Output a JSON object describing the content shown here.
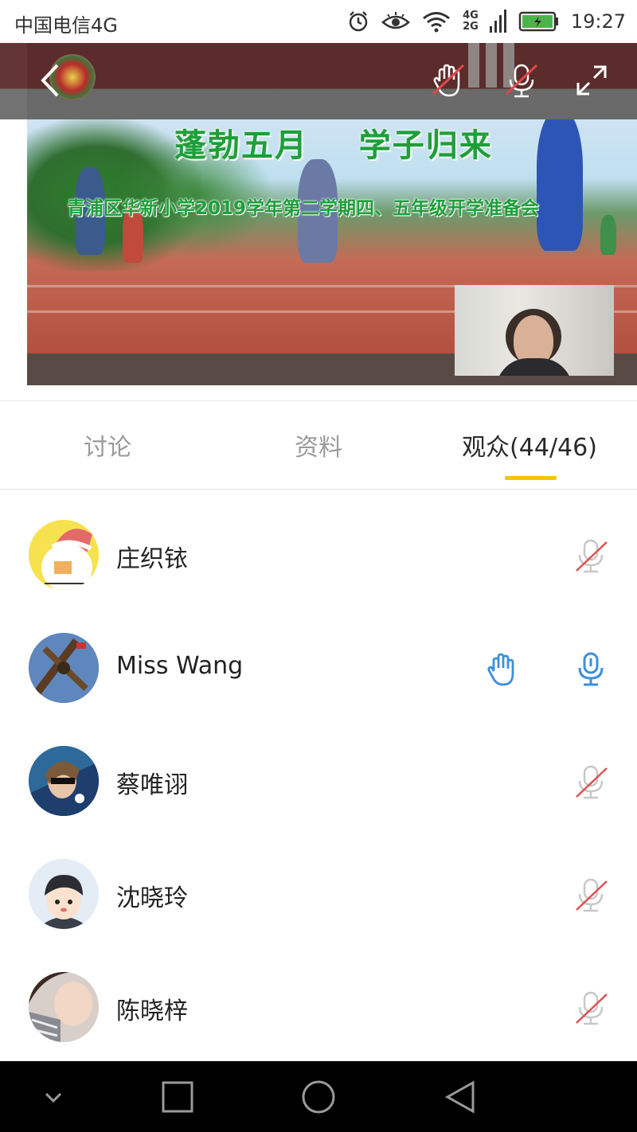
{
  "status_bar": {
    "carrier": "中国电信4G",
    "network_4g": "4G",
    "network_2g": "2G",
    "time": "19:27"
  },
  "video": {
    "banner_title": "蓬勃五月    学子归来",
    "banner_subtitle": "青浦区华新小学2019学年第二学期四、五年级开学准备会"
  },
  "tabs": [
    {
      "label": "讨论",
      "active": false
    },
    {
      "label": "资料",
      "active": false
    },
    {
      "label": "观众(44/46)",
      "active": true
    }
  ],
  "audience": [
    {
      "name": "庄织铱",
      "mic": "off",
      "hand": false
    },
    {
      "name": "Miss Wang",
      "mic": "on",
      "hand": true
    },
    {
      "name": "蔡唯诩",
      "mic": "off",
      "hand": false
    },
    {
      "name": "沈晓玲",
      "mic": "off",
      "hand": false
    },
    {
      "name": "陈晓梓",
      "mic": "off",
      "hand": false
    }
  ],
  "colors": {
    "accent_underline": "#f5c600",
    "active_mic": "#3d8fdc",
    "muted_mic": "#c8c8c8",
    "muted_slash": "#e05050",
    "banner_text": "#1e9e3a"
  },
  "icons": {
    "back": "back-chevron-icon",
    "raise_hand": "hand-muted-icon",
    "microphone": "mic-muted-icon",
    "fullscreen": "fullscreen-icon",
    "nav_down": "chevron-down-icon",
    "nav_recent": "square-icon",
    "nav_home": "circle-icon",
    "nav_back": "triangle-back-icon"
  }
}
